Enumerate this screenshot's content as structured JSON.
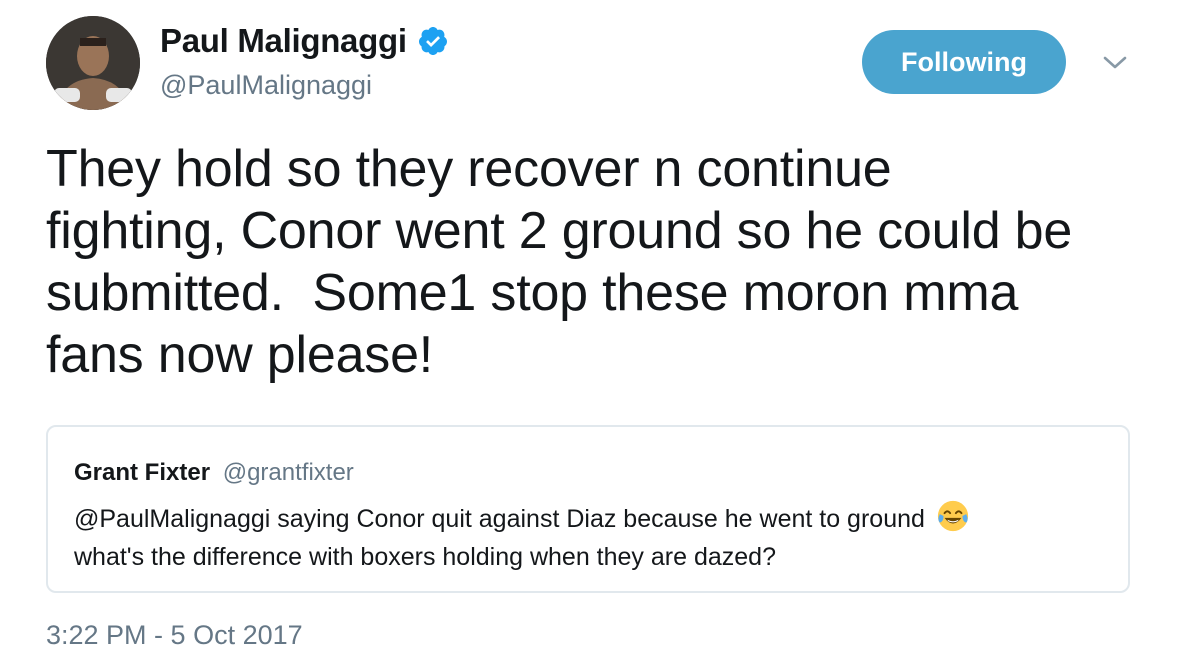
{
  "author": {
    "display_name": "Paul Malignaggi",
    "handle": "@PaulMalignaggi",
    "verified": true
  },
  "follow_button": {
    "label": "Following",
    "color": "#4aa4cf"
  },
  "tweet": {
    "text": "They hold so they recover n continue\nfighting, Conor went 2 ground so he could be\nsubmitted.  Some1 stop these moron mma\nfans now please!"
  },
  "quoted_tweet": {
    "display_name": "Grant Fixter",
    "handle": "@grantfixter",
    "text_line1": "@PaulMalignaggi saying Conor quit against Diaz because he went to ground",
    "text_line2": "what's the difference with boxers holding when they are dazed?",
    "emoji": "face-with-tears-of-joy"
  },
  "timestamp": "3:22 PM - 5 Oct 2017",
  "icons": {
    "verified": "verified-badge-icon",
    "menu": "chevron-down-icon"
  }
}
